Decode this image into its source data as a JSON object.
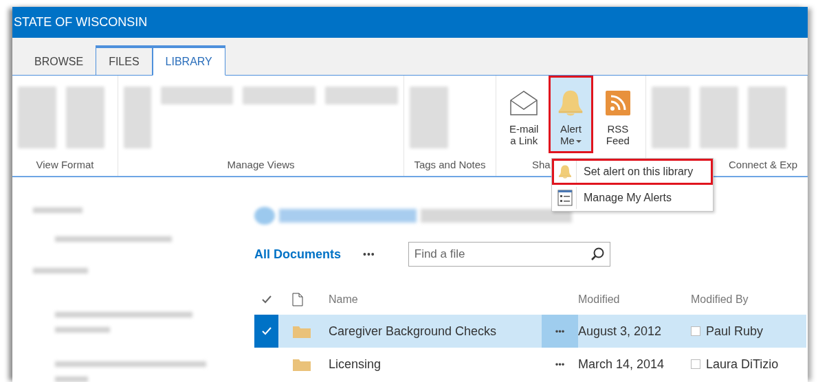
{
  "site_title": "STATE OF WISCONSIN",
  "tabs": [
    {
      "label": "BROWSE",
      "selected": false
    },
    {
      "label": "FILES",
      "selected": false
    },
    {
      "label": "LIBRARY",
      "selected": true
    }
  ],
  "ribbon_groups": [
    {
      "kind": "blurred",
      "label": "View Format"
    },
    {
      "kind": "blurred",
      "label": "Manage Views"
    },
    {
      "kind": "blurred",
      "label": "Tags and Notes"
    },
    {
      "kind": "buttons",
      "label": "Sha",
      "buttons": [
        {
          "label": "E-mail a Link",
          "kind": "envelope",
          "selected": false,
          "highlighted": false,
          "dropdown": false
        },
        {
          "label": "Alert Me",
          "kind": "bell",
          "selected": true,
          "highlighted": true,
          "dropdown": true
        },
        {
          "label": "RSS Feed",
          "kind": "rss",
          "selected": false,
          "highlighted": false,
          "dropdown": false
        }
      ]
    },
    {
      "kind": "blurred",
      "label": "Connect & Exp"
    }
  ],
  "alert_menu": [
    {
      "label": "Set alert on this library",
      "kind": "bell",
      "highlighted": true
    },
    {
      "label": "Manage My Alerts",
      "kind": "list",
      "highlighted": false
    }
  ],
  "library": {
    "view_name": "All Documents",
    "view_more": "•••",
    "search": {
      "placeholder": "Find a file"
    },
    "columns": [
      "Name",
      "Modified",
      "Modified By"
    ],
    "rows": [
      {
        "name": "Caregiver Background Checks",
        "more": "•••",
        "modified": "August 3, 2012",
        "modified_by": "Paul Ruby",
        "selected": true
      },
      {
        "name": "Licensing",
        "more": "•••",
        "modified": "March 14, 2014",
        "modified_by": "Laura DiTizio",
        "selected": false
      }
    ]
  }
}
